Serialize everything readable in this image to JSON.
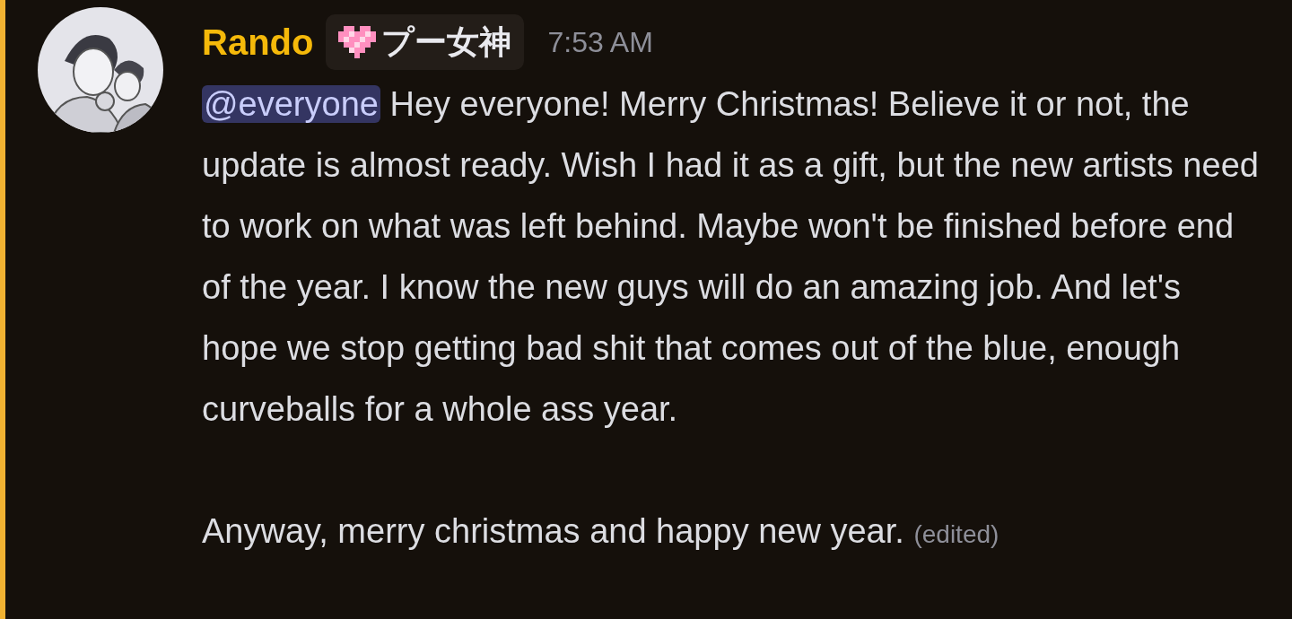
{
  "message": {
    "author": "Rando",
    "badge": {
      "text": "プー女神"
    },
    "timestamp": "7:53 AM",
    "mention": "@everyone",
    "paragraphs": [
      "Hey everyone! Merry Christmas! Believe it or not, the update is almost ready. Wish I had it as a gift, but the new artists need to work on what was left behind. Maybe won't be finished before end of the year. I know the new guys will do an amazing job. And let's hope we stop getting bad shit that comes out of the blue, enough curveballs for a whole ass year.",
      "Anyway, merry christmas and happy new year."
    ],
    "edited": "(edited)"
  }
}
